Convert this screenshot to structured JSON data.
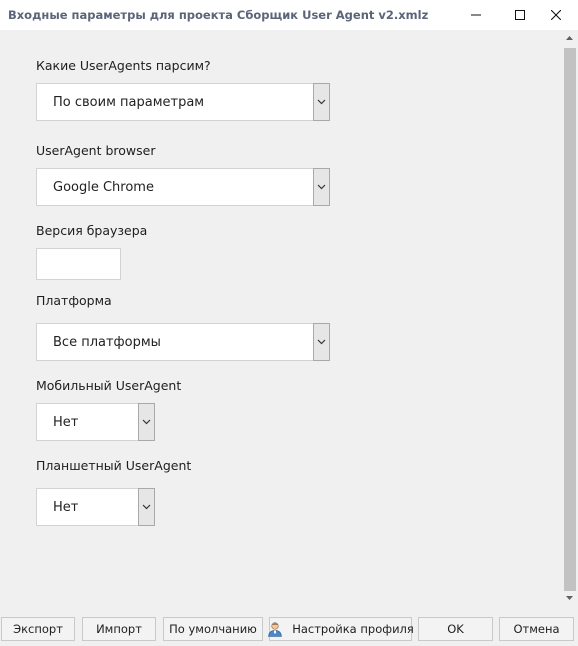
{
  "window": {
    "title": "Входные параметры для проекта Сборщик User Agent v2.xmlz"
  },
  "fields": {
    "parse_mode": {
      "label": "Какие UserAgents парсим?",
      "value": "По своим параметрам"
    },
    "browser": {
      "label": "UserAgent browser",
      "value": "Google Chrome"
    },
    "browser_version": {
      "label": "Версия браузера",
      "value": ""
    },
    "platform": {
      "label": "Платформа",
      "value": "Все платформы"
    },
    "mobile": {
      "label": "Мобильный UserAgent",
      "value": "Нет"
    },
    "tablet": {
      "label": "Планшетный UserAgent",
      "value": "Нет"
    }
  },
  "footer": {
    "export_label": "Экспорт",
    "import_label": "Импорт",
    "defaults_label": "По умолчанию",
    "profile_label": "Настройка профиля",
    "ok_label": "OK",
    "cancel_label": "Отмена"
  },
  "icons": {
    "minimize": "minimize-icon",
    "maximize": "maximize-icon",
    "close": "close-icon",
    "dropdown": "chevron-down-icon",
    "profile": "user-icon"
  }
}
